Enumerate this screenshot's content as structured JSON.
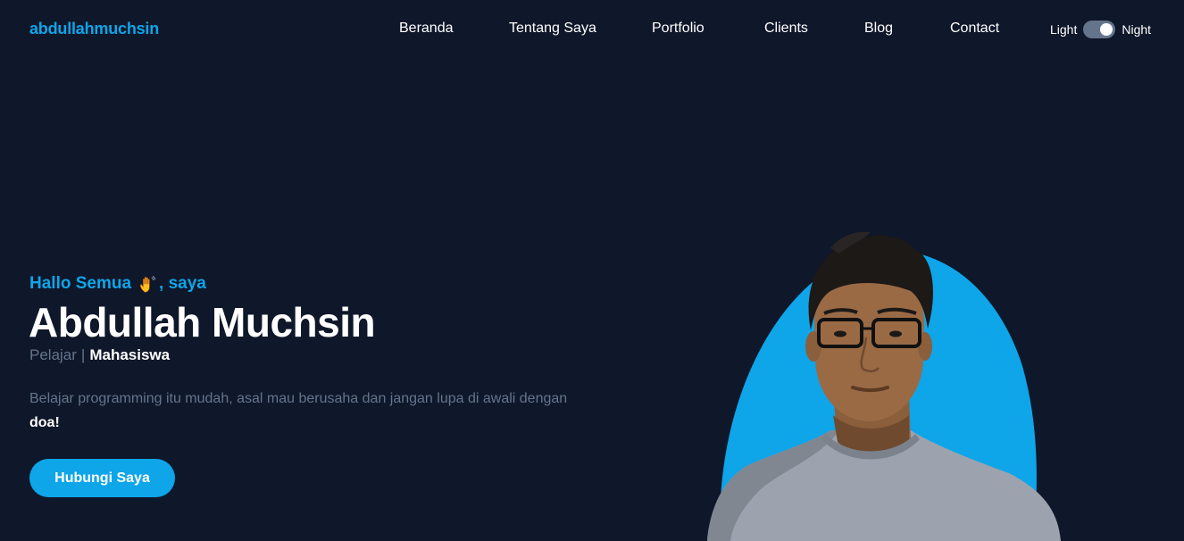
{
  "nav": {
    "brand": "abdullahmuchsin",
    "links": [
      "Beranda",
      "Tentang Saya",
      "Portfolio",
      "Clients",
      "Blog",
      "Contact"
    ],
    "theme_toggle": {
      "light_label": "Light",
      "night_label": "Night",
      "state": "night"
    }
  },
  "hero": {
    "greeting_prefix": "Hallo Semua",
    "greeting_icon": "waving-hand-icon",
    "greeting_suffix": ", saya",
    "name": "Abdullah Muchsin",
    "role_1": "Pelajar",
    "role_separator": "|",
    "role_2": "Mahasiswa",
    "description": "Belajar programming itu mudah, asal mau berusaha dan jangan lupa di awali dengan",
    "description_emphasis": "doa!",
    "cta_label": "Hubungi Saya"
  },
  "colors": {
    "background": "#0f172a",
    "accent": "#0ea5e9",
    "muted_text": "#64748b",
    "text": "#ffffff"
  }
}
